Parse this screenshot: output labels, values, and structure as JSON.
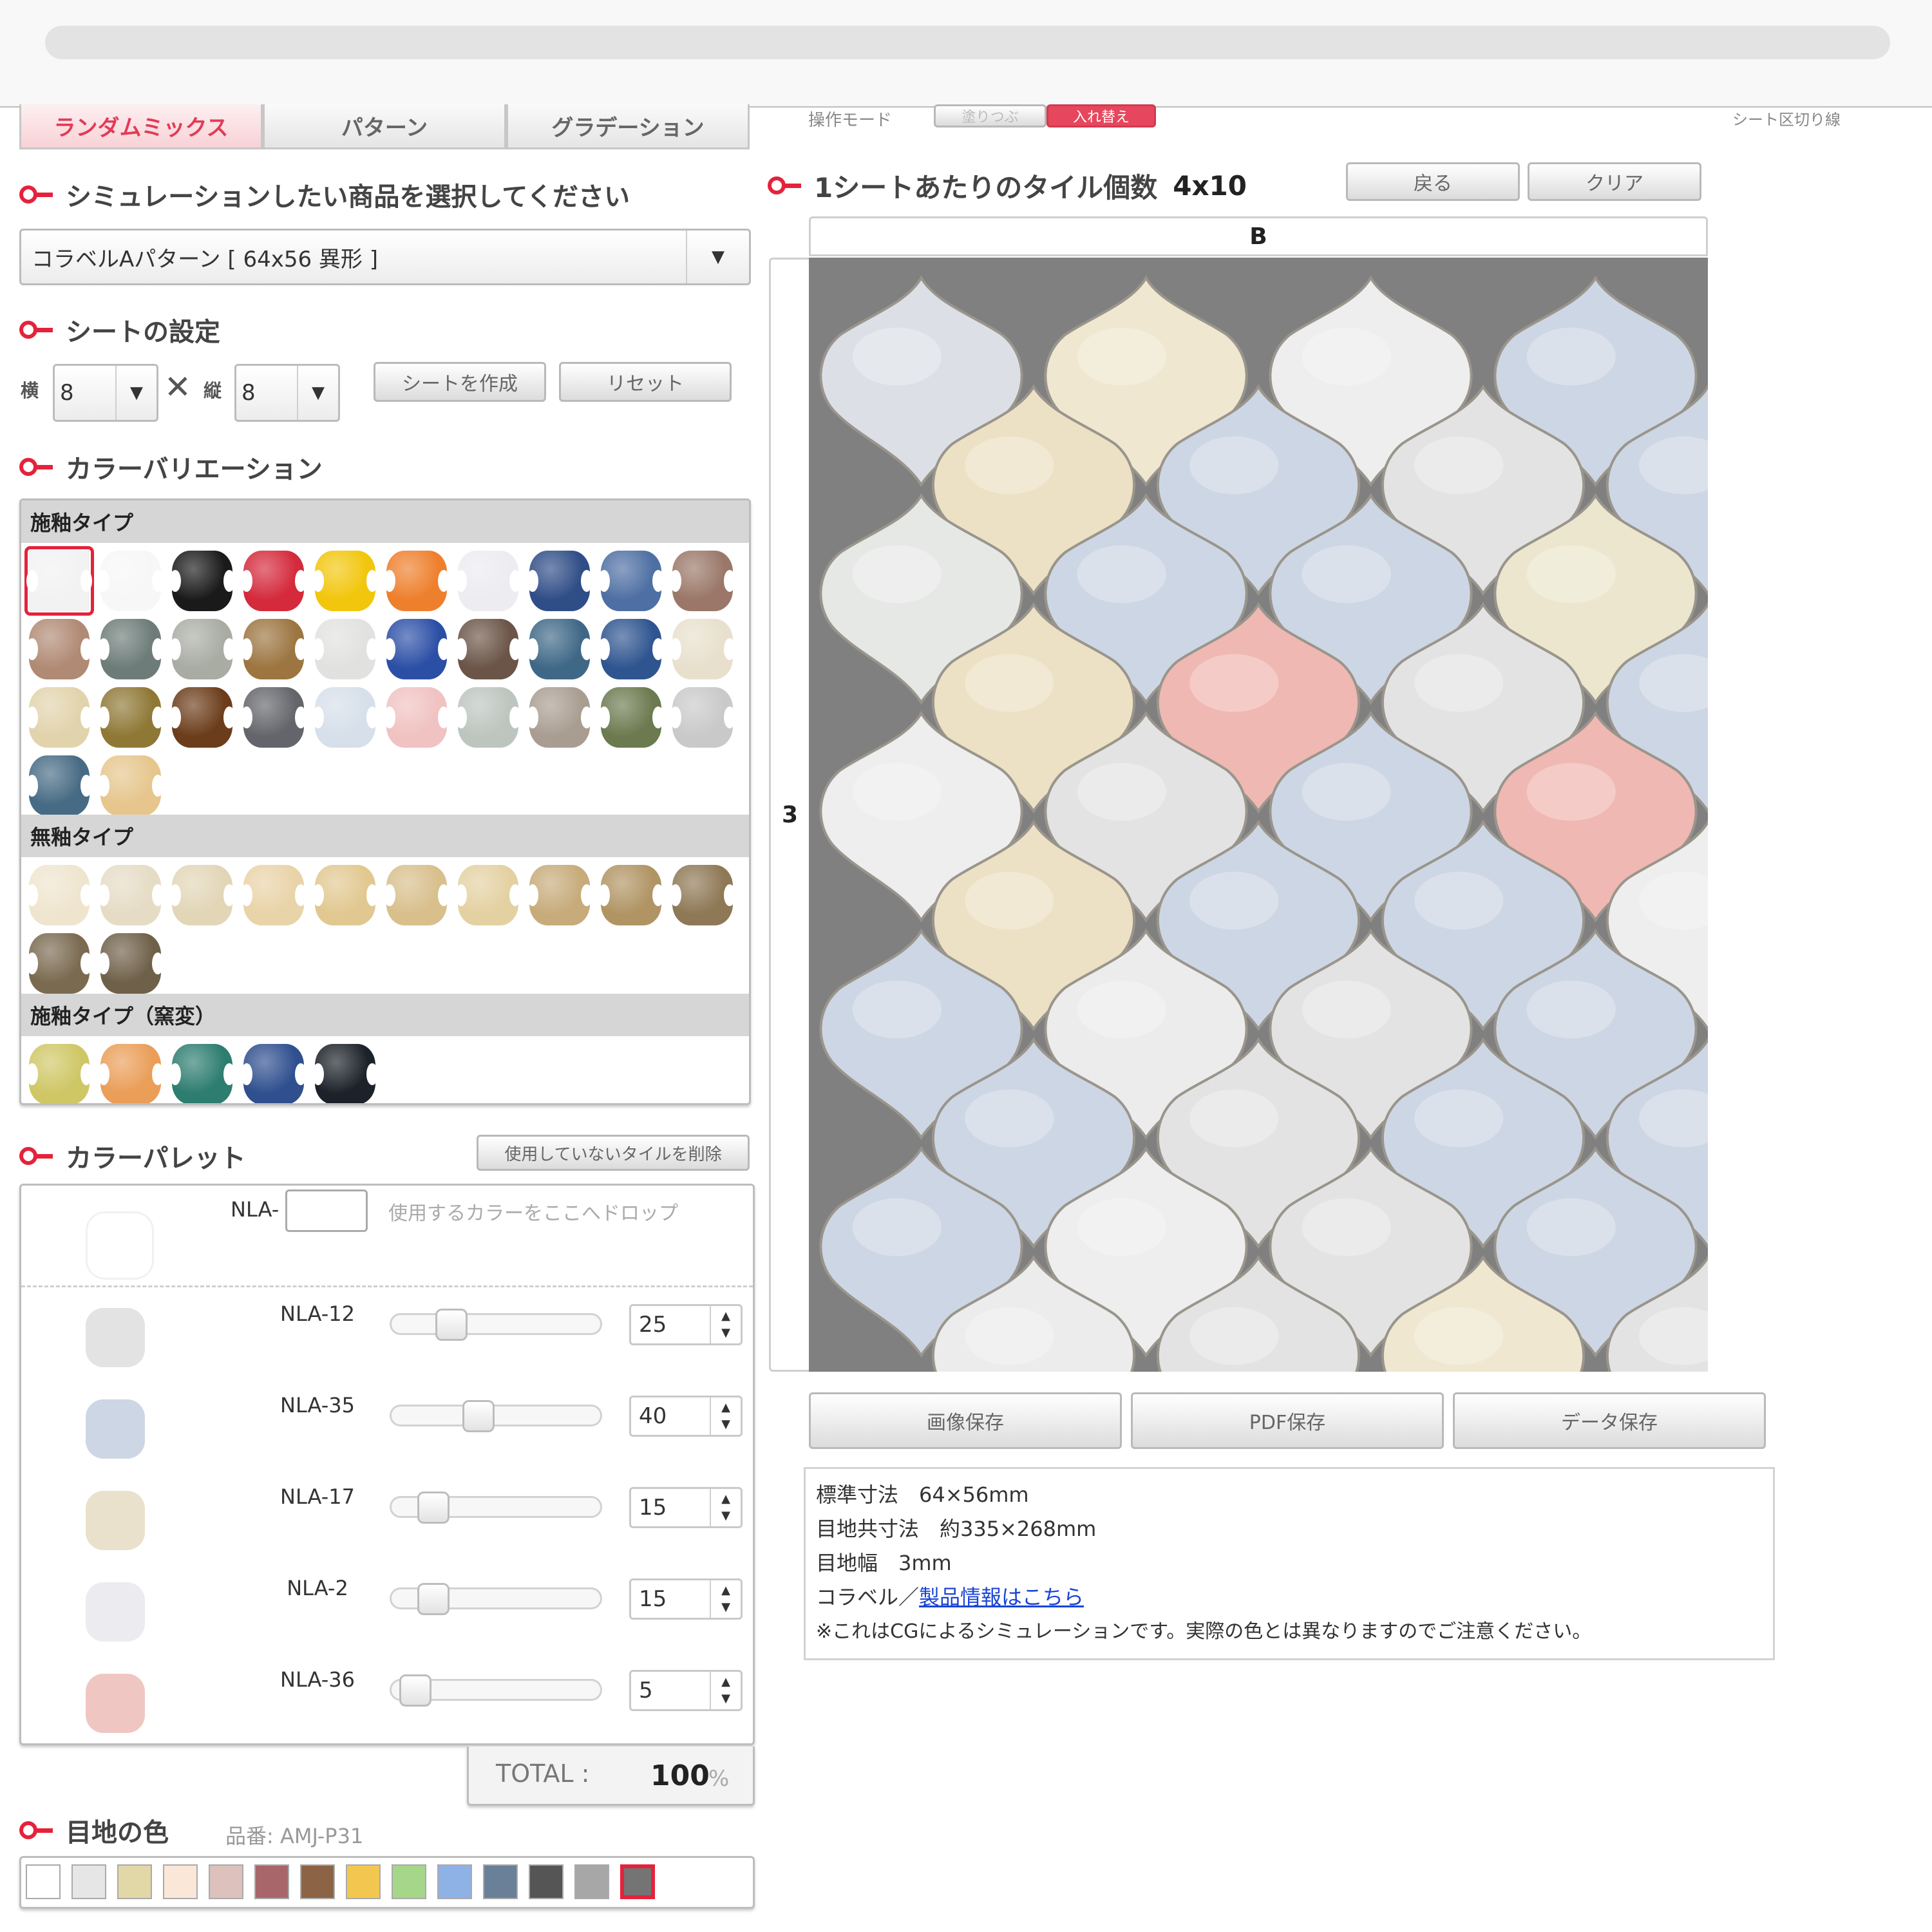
{
  "tabs": [
    "ランダムミックス",
    "パターン",
    "グラデーション"
  ],
  "top_controls": {
    "mode_label": "操作モード",
    "mode_a": "塗りつぶ",
    "mode_b": "入れ替え",
    "outline_label": "シート区切り線"
  },
  "product": {
    "heading": "シミュレーションしたい商品を選択してください",
    "selected": "コラベルAパターン [ 64x56 異形 ]"
  },
  "sheet": {
    "heading": "シートの設定",
    "width_label": "横",
    "width_value": "8",
    "times": "✕",
    "height_label": "縦",
    "height_value": "8",
    "create_button": "シートを作成",
    "reset_button": "リセット"
  },
  "color_variation": {
    "heading": "カラーバリエーション",
    "sections": [
      {
        "title": "施釉タイプ",
        "colors": [
          "#f2f2f2",
          "#f7f7f7",
          "#1a1a1a",
          "#d42a3c",
          "#f2c60c",
          "#ee7f2c",
          "#ececf1",
          "#2f4d86",
          "#4e6fa3",
          "#9a7768",
          "#b08a74",
          "#6d7c78",
          "#a9aca3",
          "#9c7540",
          "#e1e2e0",
          "#2c4fa6",
          "#6b5548",
          "#3f6887",
          "#2f5590",
          "#e8e0cd",
          "#e1d3ac",
          "#8f7836",
          "#6c3d1b",
          "#64656a",
          "#d6dfea",
          "#f0c2c1",
          "#bdc5bf",
          "#a99d91",
          "#6b7a4f",
          "#c9c9c9",
          "#476b84",
          "#e6c68d"
        ]
      },
      {
        "title": "無釉タイプ",
        "colors": [
          "#efe5cf",
          "#e6dcc5",
          "#e2d6b7",
          "#e9d3a8",
          "#e1c890",
          "#d8bf8c",
          "#e4d1a2",
          "#c7ab7a",
          "#b09463",
          "#8e7855",
          "#7a6a50",
          "#6f6049"
        ]
      },
      {
        "title": "施釉タイプ（窯変）",
        "colors": [
          "#cfc766",
          "#ea9e58",
          "#2d7d70",
          "#2f4f8f",
          "#1c2229"
        ]
      }
    ]
  },
  "palette": {
    "heading": "カラーパレット",
    "remove_unused_button": "使用していないタイルを削除",
    "drop_prefix": "NLA-",
    "drop_hint": "使用するカラーをここへドロップ",
    "items": [
      {
        "name": "NLA-12",
        "value": "25",
        "share": 0.25,
        "color": "#e3e3e3"
      },
      {
        "name": "NLA-35",
        "value": "40",
        "share": 0.4,
        "color": "#cdd6e4"
      },
      {
        "name": "NLA-17",
        "value": "15",
        "share": 0.15,
        "color": "#e9e1cb"
      },
      {
        "name": "NLA-2",
        "value": "15",
        "share": 0.15,
        "color": "#ececf0"
      },
      {
        "name": "NLA-36",
        "value": "5",
        "share": 0.05,
        "color": "#f0c6c3"
      }
    ],
    "total_label": "TOTAL :",
    "total_value": "100",
    "total_unit": "%"
  },
  "joint_color": {
    "heading": "目地の色",
    "code_label": "品番: AMJ-P31",
    "colors": [
      "#ffffff",
      "#e6e6e6",
      "#e2d7a6",
      "#fbe7d8",
      "#dcc1bd",
      "#a8666b",
      "#8c6445",
      "#f3c74f",
      "#a6d68a",
      "#8fb2e6",
      "#6a7f98",
      "#555555",
      "#a7a7a7",
      "#747474"
    ],
    "selected_index": 13
  },
  "preview": {
    "title": "1シートあたりのタイル個数",
    "count": "4x10",
    "back_button": "戻る",
    "clear_button": "クリア",
    "column_label": "B",
    "row_label": "3",
    "grout_color": "#808080",
    "tile_rows": [
      [
        "#dce0e6",
        "#efe7cf",
        "#eeeeee",
        "#cdd6e4"
      ],
      [
        "#ece1c4",
        "#cdd6e4",
        "#e3e3e3",
        "#cdd6e4"
      ],
      [
        "#e6e8e6",
        "#cdd6e4",
        "#cdd6e4",
        "#ece6ce"
      ],
      [
        "#ece1c4",
        "#f0b8b2",
        "#e3e3e3",
        "#cdd6e4"
      ],
      [
        "#eeeeee",
        "#e3e3e3",
        "#cdd6e4",
        "#f0b8b2"
      ],
      [
        "#ece1c4",
        "#cdd6e4",
        "#cdd6e4",
        "#eeeeee"
      ],
      [
        "#cdd6e4",
        "#ececec",
        "#e3e3e3",
        "#cdd6e4"
      ],
      [
        "#cdd6e4",
        "#e3e3e3",
        "#cdd6e4",
        "#cdd6e4"
      ],
      [
        "#cdd6e4",
        "#eeeeee",
        "#e3e3e3",
        "#cdd6e4"
      ],
      [
        "#ececec",
        "#e3e3e3",
        "#efe7cf",
        "#e3e3e3"
      ]
    ]
  },
  "save_buttons": [
    "画像保存",
    "PDF保存",
    "データ保存"
  ],
  "info": {
    "size": "標準寸法　64×56mm",
    "joint_size": "目地共寸法　約335×268mm",
    "joint_width": "目地幅　3mm",
    "brand": "コラベル／",
    "link": "製品情報はこちら",
    "note": "※これはCGによるシミュレーションです。実際の色とは異なりますのでご注意ください。"
  }
}
